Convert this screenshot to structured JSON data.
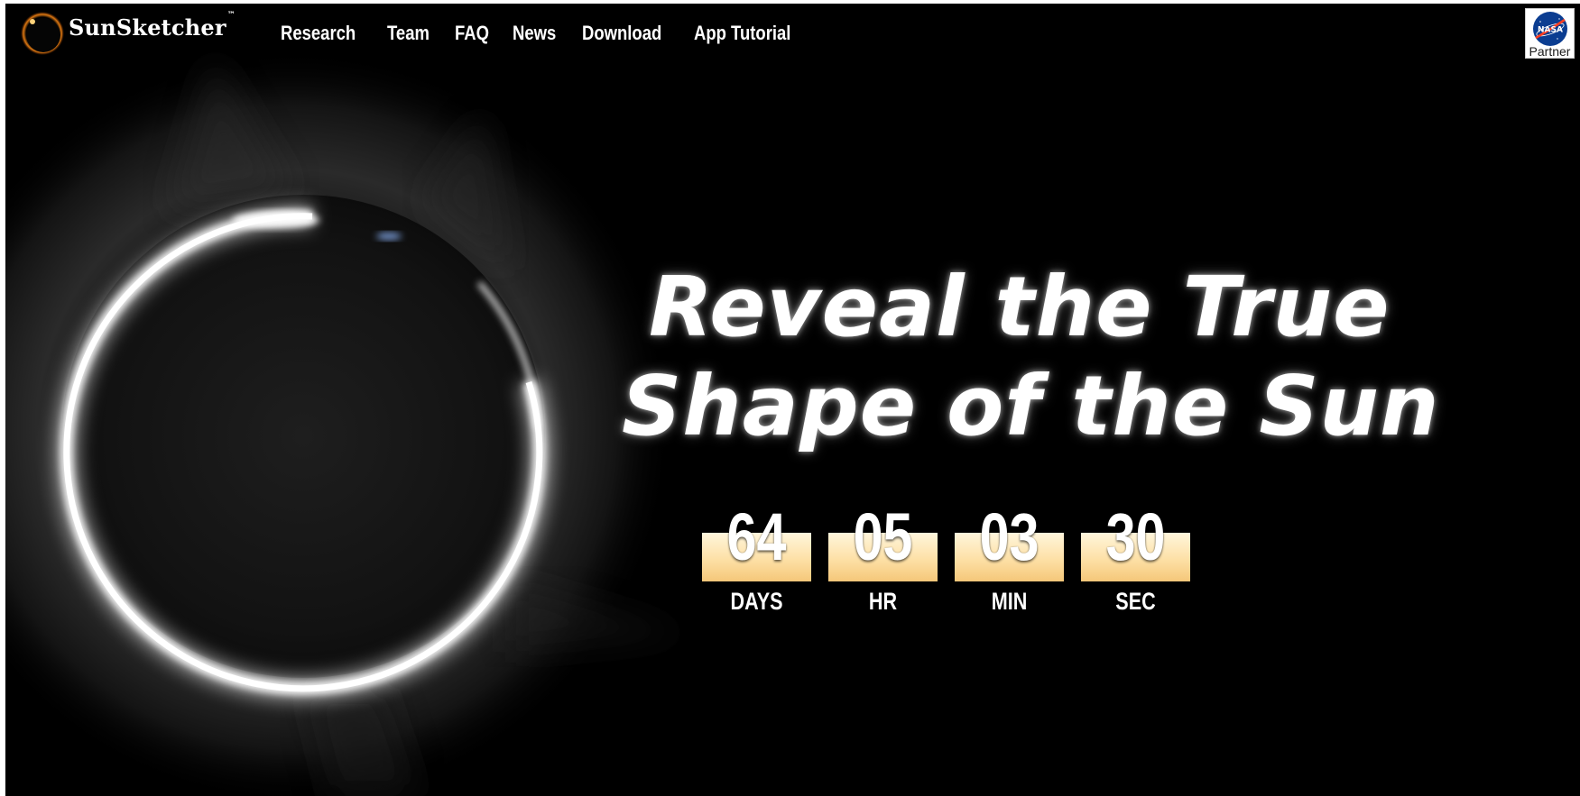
{
  "brand": {
    "name": "SunSketcher",
    "trademark": "™"
  },
  "nav": {
    "items": [
      {
        "label": "Research",
        "id": "research"
      },
      {
        "label": "Team",
        "id": "team"
      },
      {
        "label": "FAQ",
        "id": "faq"
      },
      {
        "label": "News",
        "id": "news"
      },
      {
        "label": "Download",
        "id": "download"
      },
      {
        "label": "App Tutorial",
        "id": "app-tutorial"
      }
    ]
  },
  "partner_badge": {
    "logo_text": "NASA",
    "label": "Partner"
  },
  "hero": {
    "headline_line1": "Reveal the True",
    "headline_line2": "Shape of the Sun",
    "image_icon": "solar-eclipse-diamond-ring"
  },
  "countdown": {
    "days": {
      "value": "64",
      "label": "DAYS"
    },
    "hours": {
      "value": "05",
      "label": "HR"
    },
    "minutes": {
      "value": "03",
      "label": "MIN"
    },
    "seconds": {
      "value": "30",
      "label": "SEC"
    }
  },
  "colors": {
    "background": "#000000",
    "text": "#ffffff",
    "countdown_box_top": "#fff6dc",
    "countdown_box_bottom": "#f5c779",
    "nasa_blue": "#0b3d91",
    "nasa_red": "#fc3d21"
  }
}
